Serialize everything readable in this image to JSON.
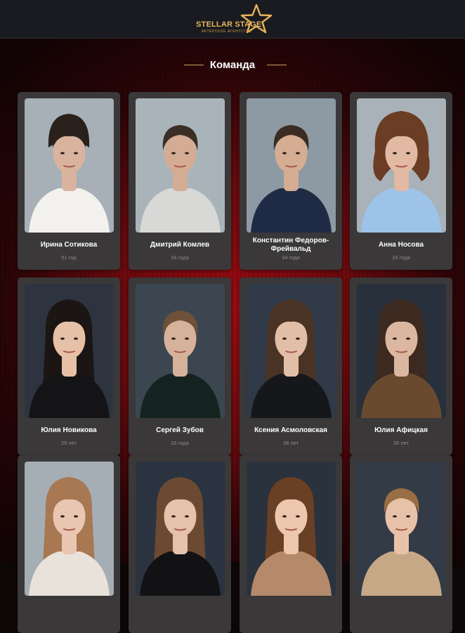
{
  "header": {
    "logo_text": "STELLAR STAGE",
    "logo_subtitle": "АКТЕРСКОЕ АГЕНТСТВО",
    "accent": "#e6b45a"
  },
  "section": {
    "title": "Команда"
  },
  "team": [
    {
      "name": "Ирина Сотикова",
      "age": "51 год",
      "bg": "#a6b0b6",
      "hair": "#2a211c",
      "skin": "#d9b39e",
      "cloth": "#f2f1ee",
      "hairStyle": "bun"
    },
    {
      "name": "Дмитрий Комлев",
      "age": "34 года",
      "bg": "#a9b4ba",
      "hair": "#3a2f27",
      "skin": "#d4ac93",
      "cloth": "#d8d8d6",
      "hairStyle": "short"
    },
    {
      "name": "Константин Федоров-Фрейвальд",
      "age": "34 года",
      "bg": "#8d9aa3",
      "hair": "#3a2c22",
      "skin": "#d5ad93",
      "cloth": "#1f2a44",
      "hairStyle": "short"
    },
    {
      "name": "Анна Носова",
      "age": "33 года",
      "bg": "#a9b2b8",
      "hair": "#6a3d24",
      "skin": "#e2b9a2",
      "cloth": "#9ec3e8",
      "hairStyle": "curly"
    },
    {
      "name": "Юлия Новикова",
      "age": "29 лет",
      "bg": "#2d3440",
      "hair": "#1b1513",
      "skin": "#e6c0a7",
      "cloth": "#141416",
      "hairStyle": "long"
    },
    {
      "name": "Сергей Зубов",
      "age": "33 года",
      "bg": "#3c4650",
      "hair": "#6d5138",
      "skin": "#d7b29a",
      "cloth": "#14231f",
      "hairStyle": "short"
    },
    {
      "name": "Ксения Асмоловская",
      "age": "38 лет",
      "bg": "#2f3947",
      "hair": "#4a3325",
      "skin": "#e3bea6",
      "cloth": "#16171b",
      "hairStyle": "long"
    },
    {
      "name": "Юлия Афицкая",
      "age": "36 лет",
      "bg": "#27303b",
      "hair": "#3c2a21",
      "skin": "#dcb7a0",
      "cloth": "#6a4a2e",
      "hairStyle": "long"
    },
    {
      "name": "",
      "age": "",
      "bg": "#a5aeb4",
      "hair": "#a77852",
      "skin": "#e9c6b2",
      "cloth": "#e8e2da",
      "hairStyle": "long"
    },
    {
      "name": "",
      "age": "",
      "bg": "#2b3340",
      "hair": "#6b4a31",
      "skin": "#e6c2aa",
      "cloth": "#121214",
      "hairStyle": "long"
    },
    {
      "name": "",
      "age": "",
      "bg": "#2a323d",
      "hair": "#6a4025",
      "skin": "#ecc6ad",
      "cloth": "#b48a6b",
      "hairStyle": "long"
    },
    {
      "name": "",
      "age": "",
      "bg": "#323b46",
      "hair": "#9a6e44",
      "skin": "#e7c2a8",
      "cloth": "#c7a886",
      "hairStyle": "short"
    }
  ]
}
